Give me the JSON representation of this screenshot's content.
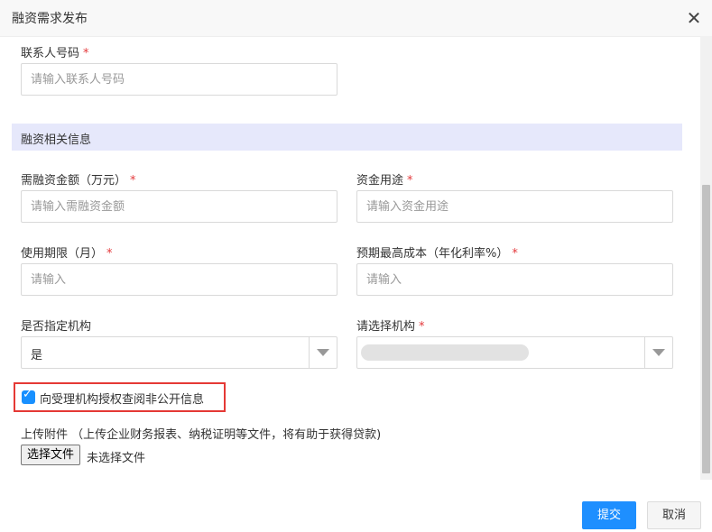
{
  "dialog": {
    "title": "融资需求发布",
    "close_glyph": "✕"
  },
  "contact": {
    "label": "联系人号码",
    "required_mark": "*",
    "placeholder": "请输入联系人号码"
  },
  "section": {
    "title": "融资相关信息"
  },
  "fields": {
    "amount": {
      "label": "需融资金额（万元）",
      "required_mark": "*",
      "placeholder": "请输入需融资金额"
    },
    "purpose": {
      "label": "资金用途",
      "required_mark": "*",
      "placeholder": "请输入资金用途"
    },
    "term": {
      "label": "使用期限（月）",
      "required_mark": "*",
      "placeholder": "请输入"
    },
    "cost": {
      "label": "预期最高成本（年化利率%）",
      "required_mark": "*",
      "placeholder": "请输入"
    },
    "designated": {
      "label": "是否指定机构",
      "selected": "是"
    },
    "institution": {
      "label": "请选择机构",
      "required_mark": "*",
      "selected": ""
    }
  },
  "consent": {
    "checked": true,
    "label": "向受理机构授权查阅非公开信息",
    "highlight_color": "#e53935"
  },
  "upload": {
    "label": "上传附件 （上传企业财务报表、纳税证明等文件，将有助于获得贷款)",
    "button": "选择文件",
    "status": "未选择文件"
  },
  "actions": {
    "submit": "提交",
    "cancel": "取消"
  },
  "colors": {
    "primary": "#1e8fff",
    "section_band": "#e6e8fb",
    "required": "#e4393c"
  }
}
